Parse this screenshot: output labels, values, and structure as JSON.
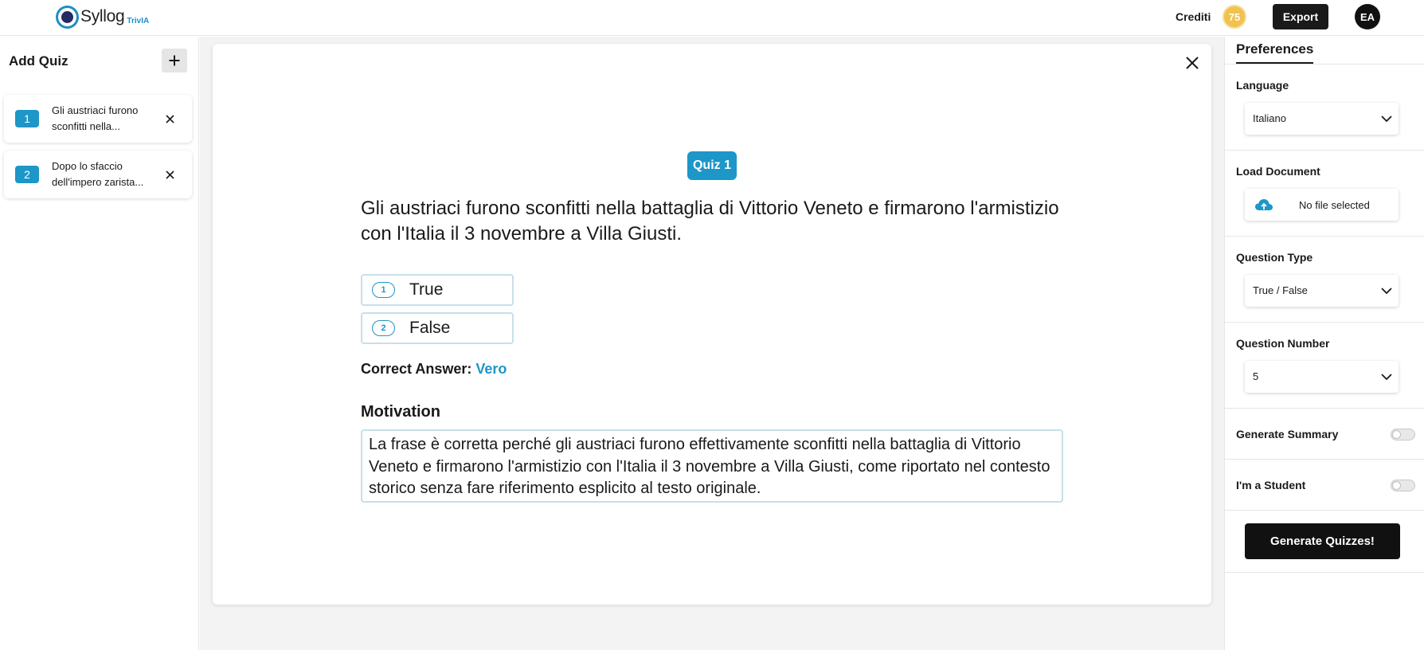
{
  "header": {
    "logo_text": "Syllog",
    "logo_sub": "TrivIA",
    "credits_label": "Crediti",
    "credits_value": "75",
    "export_label": "Export",
    "avatar_initials": "EA"
  },
  "sidebar": {
    "title": "Add Quiz",
    "items": [
      {
        "number": "1",
        "text": "Gli austriaci furono sconfitti nella..."
      },
      {
        "number": "2",
        "text": "Dopo lo sfaccio dell'impero zarista..."
      }
    ]
  },
  "quiz": {
    "badge": "Quiz 1",
    "question": "Gli austriaci furono sconfitti nella battaglia di Vittorio Veneto e firmarono l'armistizio con l'Italia il 3 novembre a Villa Giusti.",
    "options": [
      {
        "number": "1",
        "label": "True"
      },
      {
        "number": "2",
        "label": "False"
      }
    ],
    "correct_label": "Correct Answer:",
    "correct_value": "Vero",
    "motivation_title": "Motivation",
    "motivation_text": "La frase è corretta perché gli austriaci furono effettivamente sconfitti nella battaglia di Vittorio Veneto e firmarono l'armistizio con l'Italia il 3 novembre a Villa Giusti, come riportato nel contesto storico senza fare riferimento esplicito al testo originale."
  },
  "preferences": {
    "tab_label": "Preferences",
    "language_label": "Language",
    "language_value": "Italiano",
    "load_document_label": "Load Document",
    "file_status": "No file selected",
    "question_type_label": "Question Type",
    "question_type_value": "True / False",
    "question_number_label": "Question Number",
    "question_number_value": "5",
    "generate_summary_label": "Generate Summary",
    "generate_summary_on": false,
    "student_label": "I'm a Student",
    "student_on": false,
    "generate_button": "Generate Quizzes!"
  },
  "colors": {
    "accent": "#1d96c8",
    "credits_badge": "#f0c24e",
    "button_dark": "#111111"
  },
  "icons": {
    "add": "plus-icon",
    "remove": "close-icon",
    "dropdown": "chevron-down-icon",
    "upload": "cloud-upload-icon"
  }
}
